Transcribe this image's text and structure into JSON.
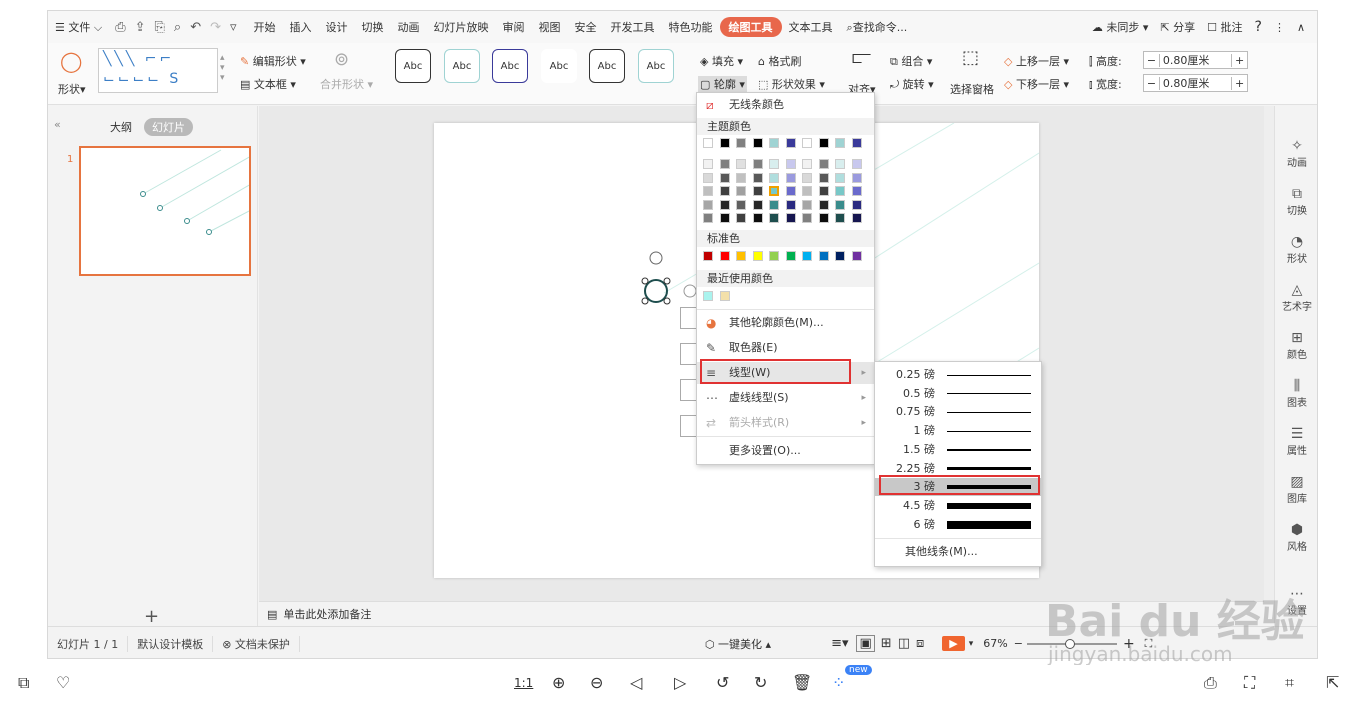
{
  "menubar": {
    "file": "文件",
    "tabs": [
      "开始",
      "插入",
      "设计",
      "切换",
      "动画",
      "幻灯片放映",
      "审阅",
      "视图",
      "安全",
      "开发工具",
      "特色功能",
      "绘图工具",
      "文本工具"
    ],
    "active_tab": "绘图工具",
    "search": "查找命令...",
    "sync": "未同步",
    "share": "分享",
    "comment": "批注"
  },
  "ribbon": {
    "shape": "形状",
    "edit_shape": "编辑形状",
    "textbox": "文本框",
    "merge_shape": "合并形状",
    "style_label": "Abc",
    "fill": "填充",
    "format_brush": "格式刷",
    "outline": "轮廓",
    "shape_effect": "形状效果",
    "align": "对齐",
    "group": "组合",
    "rotate": "旋转",
    "select_pane": "选择窗格",
    "bring_forward": "上移一层",
    "send_backward": "下移一层",
    "height_label": "高度:",
    "height_value": "0.80厘米",
    "width_label": "宽度:",
    "width_value": "0.80厘米"
  },
  "leftpanel": {
    "outline_tab": "大纲",
    "slide_tab": "幻灯片",
    "slide_number": "1"
  },
  "notes": "单击此处添加备注",
  "rightbar": [
    "动画",
    "切换",
    "形状",
    "艺术字",
    "颜色",
    "图表",
    "属性",
    "图库",
    "风格",
    "设置"
  ],
  "statusbar": {
    "slide": "幻灯片 1 / 1",
    "template": "默认设计模板",
    "protect": "文档未保护",
    "beautify": "一键美化",
    "zoom": "67%"
  },
  "dropdown": {
    "no_line": "无线条颜色",
    "theme_colors": "主题颜色",
    "standard_colors": "标准色",
    "recent_colors": "最近使用颜色",
    "more_colors": "其他轮廓颜色(M)...",
    "eyedropper": "取色器(E)",
    "line_type": "线型(W)",
    "dash_type": "虚线线型(S)",
    "arrow_style": "箭头样式(R)",
    "more_settings": "更多设置(O)..."
  },
  "theme_top": [
    "#ffffff",
    "#000000",
    "#808080",
    "#000000",
    "#9fd3d3",
    "#3a3a9a",
    "#ffffff",
    "#000000",
    "#9fd3d3",
    "#3a3a9a"
  ],
  "theme_shades": [
    [
      "#f2f2f2",
      "#7f7f7f",
      "#e0e0e0",
      "#7f7f7f",
      "#d8eeee",
      "#c8c8ee",
      "#f2f2f2",
      "#7f7f7f",
      "#d8eeee",
      "#c8c8ee"
    ],
    [
      "#d9d9d9",
      "#595959",
      "#c0c0c0",
      "#595959",
      "#b0dede",
      "#9a9ade",
      "#d9d9d9",
      "#595959",
      "#b0dede",
      "#9a9ade"
    ],
    [
      "#bfbfbf",
      "#404040",
      "#a0a0a0",
      "#404040",
      "#78c8c8",
      "#6a6acc",
      "#bfbfbf",
      "#404040",
      "#78c8c8",
      "#6a6acc"
    ],
    [
      "#a6a6a6",
      "#262626",
      "#606060",
      "#262626",
      "#3a8c8c",
      "#2a2a80",
      "#a6a6a6",
      "#262626",
      "#3a8c8c",
      "#2a2a80"
    ],
    [
      "#808080",
      "#0d0d0d",
      "#404040",
      "#0d0d0d",
      "#1e4e4e",
      "#161650",
      "#808080",
      "#0d0d0d",
      "#1e4e4e",
      "#161650"
    ]
  ],
  "standard": [
    "#c00000",
    "#ff0000",
    "#ffc000",
    "#ffff00",
    "#92d050",
    "#00b050",
    "#00b0f0",
    "#0070c0",
    "#002060",
    "#7030a0"
  ],
  "recent": [
    "#aaf3ee",
    "#f3e0aa"
  ],
  "line_weights": [
    {
      "label": "0.25 磅",
      "pt": 0.25
    },
    {
      "label": "0.5 磅",
      "pt": 0.5
    },
    {
      "label": "0.75 磅",
      "pt": 0.75
    },
    {
      "label": "1 磅",
      "pt": 1
    },
    {
      "label": "1.5 磅",
      "pt": 1.5
    },
    {
      "label": "2.25 磅",
      "pt": 2.25
    },
    {
      "label": "3 磅",
      "pt": 3
    },
    {
      "label": "4.5 磅",
      "pt": 4.5
    },
    {
      "label": "6 磅",
      "pt": 6
    }
  ],
  "selected_weight": "3 磅",
  "more_lines": "其他线条(M)...",
  "bottombar": {
    "ratio": "1:1",
    "badge": "new"
  },
  "watermark": {
    "logo": "Bai du 经验",
    "url": "jingyan.baidu.com"
  }
}
